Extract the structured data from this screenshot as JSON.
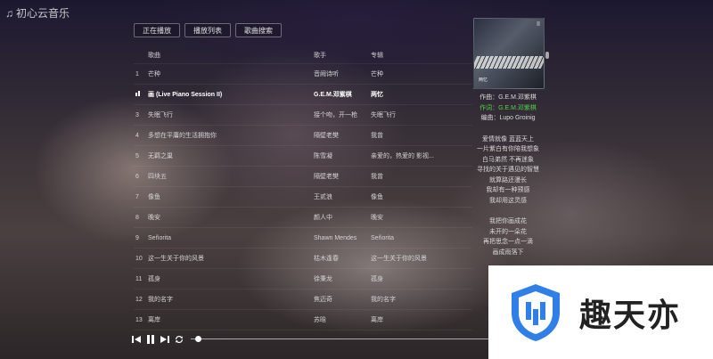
{
  "app": {
    "title": "初心云音乐",
    "icon": "music-note-icon"
  },
  "tabs": [
    {
      "label": "正在播放"
    },
    {
      "label": "播放列表"
    },
    {
      "label": "歌曲搜索"
    }
  ],
  "list": {
    "headers": {
      "title": "歌曲",
      "artist": "歌手",
      "album": "专辑"
    },
    "rows": [
      {
        "num": "1",
        "title": "芒种",
        "artist": "音阙诗听",
        "album": "芒种",
        "playing": false
      },
      {
        "num": "",
        "title": "画 (Live Piano Session II)",
        "artist": "G.E.M.邓紫棋",
        "album": "两忆",
        "playing": true
      },
      {
        "num": "3",
        "title": "失眠飞行",
        "artist": "接个吻，开一枪",
        "album": "失眠飞行",
        "playing": false
      },
      {
        "num": "4",
        "title": "多想在平庸的生活拥抱你",
        "artist": "隔壁老樊",
        "album": "我曾",
        "playing": false
      },
      {
        "num": "5",
        "title": "无羁之巢",
        "artist": "陈雪凝",
        "album": "亲爱的，热爱的 影视...",
        "playing": false
      },
      {
        "num": "6",
        "title": "四块五",
        "artist": "隔壁老樊",
        "album": "我曾",
        "playing": false
      },
      {
        "num": "7",
        "title": "像鱼",
        "artist": "王贰浪",
        "album": "像鱼",
        "playing": false
      },
      {
        "num": "8",
        "title": "晚安",
        "artist": "颜人中",
        "album": "晚安",
        "playing": false
      },
      {
        "num": "9",
        "title": "Señorita",
        "artist": "Shawn Mendes",
        "album": "Señorita",
        "playing": false
      },
      {
        "num": "10",
        "title": "这一生关于你的风景",
        "artist": "枯木逢春",
        "album": "这一生关于你的风景",
        "playing": false
      },
      {
        "num": "11",
        "title": "孤身",
        "artist": "徐秉龙",
        "album": "孤身",
        "playing": false
      },
      {
        "num": "12",
        "title": "我的名字",
        "artist": "焦迈奇",
        "album": "我的名字",
        "playing": false
      },
      {
        "num": "13",
        "title": "离岸",
        "artist": "苏晗",
        "album": "离岸",
        "playing": false
      }
    ]
  },
  "cover": {
    "text": "两忆",
    "mark": "II"
  },
  "lyrics": {
    "credits": [
      {
        "text": "作曲：G.E.M.邓紫棋",
        "active": false
      },
      {
        "text": "作词：G.E.M.邓紫棋",
        "active": true
      },
      {
        "text": "编曲：Lupo Groinig",
        "active": false
      }
    ],
    "verse1": [
      "爱情就像 蓝蓝天上",
      "一片紫白有你陪我想象",
      "白马弟然 不再迷象",
      "寻找的关于遇见的智慧",
      "就算路还漫长",
      "我却有一种预感",
      "我却用这灵感"
    ],
    "verse2": [
      "我把你画成花",
      "未开的一朵花",
      "再把思念一点一滴",
      "画成雨落下"
    ]
  },
  "player": {
    "prev": "prev-icon",
    "pause": "pause-icon",
    "next": "next-icon",
    "loop": "loop-icon",
    "progress": 0.02
  },
  "watermark": {
    "text": "趣天亦",
    "accent": "#2f7fe6"
  },
  "colors": {
    "active_lyric": "#4fd14b"
  }
}
